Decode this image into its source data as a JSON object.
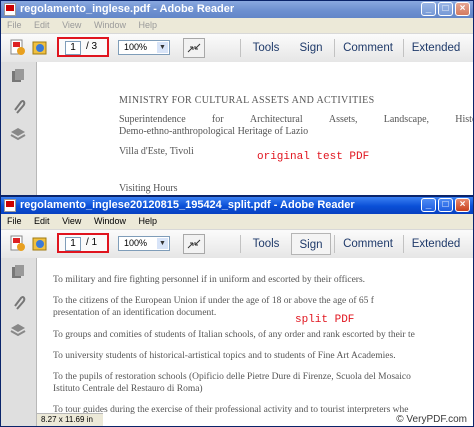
{
  "window1": {
    "title": "regolamento_inglese.pdf - Adobe Reader",
    "menu": [
      "File",
      "Edit",
      "View",
      "Window",
      "Help"
    ],
    "toolbar": {
      "page_current": "1",
      "page_total": "/ 3",
      "zoom": "100%",
      "buttons": [
        "Tools",
        "Sign",
        "Comment",
        "Extended"
      ]
    },
    "document": {
      "heading": "MINISTRY FOR CULTURAL ASSETS AND ACTIVITIES",
      "line1_words": [
        "Superintendence",
        "for",
        "Architectural",
        "Assets,",
        "Landscape,",
        "Histo"
      ],
      "line2": "Demo-ethno-anthropological Heritage of Lazio",
      "line3": "Villa d'Este, Tivoli",
      "line4": "Visiting Hours",
      "annotation": "original test PDF"
    }
  },
  "window2": {
    "title": "regolamento_inglese20120815_195424_split.pdf - Adobe Reader",
    "menu": [
      "File",
      "Edit",
      "View",
      "Window",
      "Help"
    ],
    "toolbar": {
      "page_current": "1",
      "page_total": "/ 1",
      "zoom": "100%",
      "buttons": [
        "Tools",
        "Sign",
        "Comment",
        "Extended"
      ]
    },
    "document": {
      "lines": [
        "To military and fire fighting personnel if in uniform and escorted by their officers.",
        "To the citizens of the European Union if under the age of 18 or above the age of 65 f",
        "presentation of an identification document.",
        "To groups and comities of students of Italian schools, of any order and rank escorted by their te",
        "To university students of historical-artistical topics and to students of Fine Art Academies.",
        "To the pupils of restoration schools (Opificio delle Pietre Dure di Firenze, Scuola del Mosaico",
        "Istituto Centrale del Restauro di Roma)",
        "To tour guides during the exercise of their professional activity and to tourist interpreters whe"
      ],
      "annotation": "split PDF"
    },
    "status": "8.27 x 11.69 in"
  },
  "watermark": "© VeryPDF.com",
  "colors": {
    "highlight": "#e0141e",
    "titlebar_active": "#0a4fd6"
  }
}
